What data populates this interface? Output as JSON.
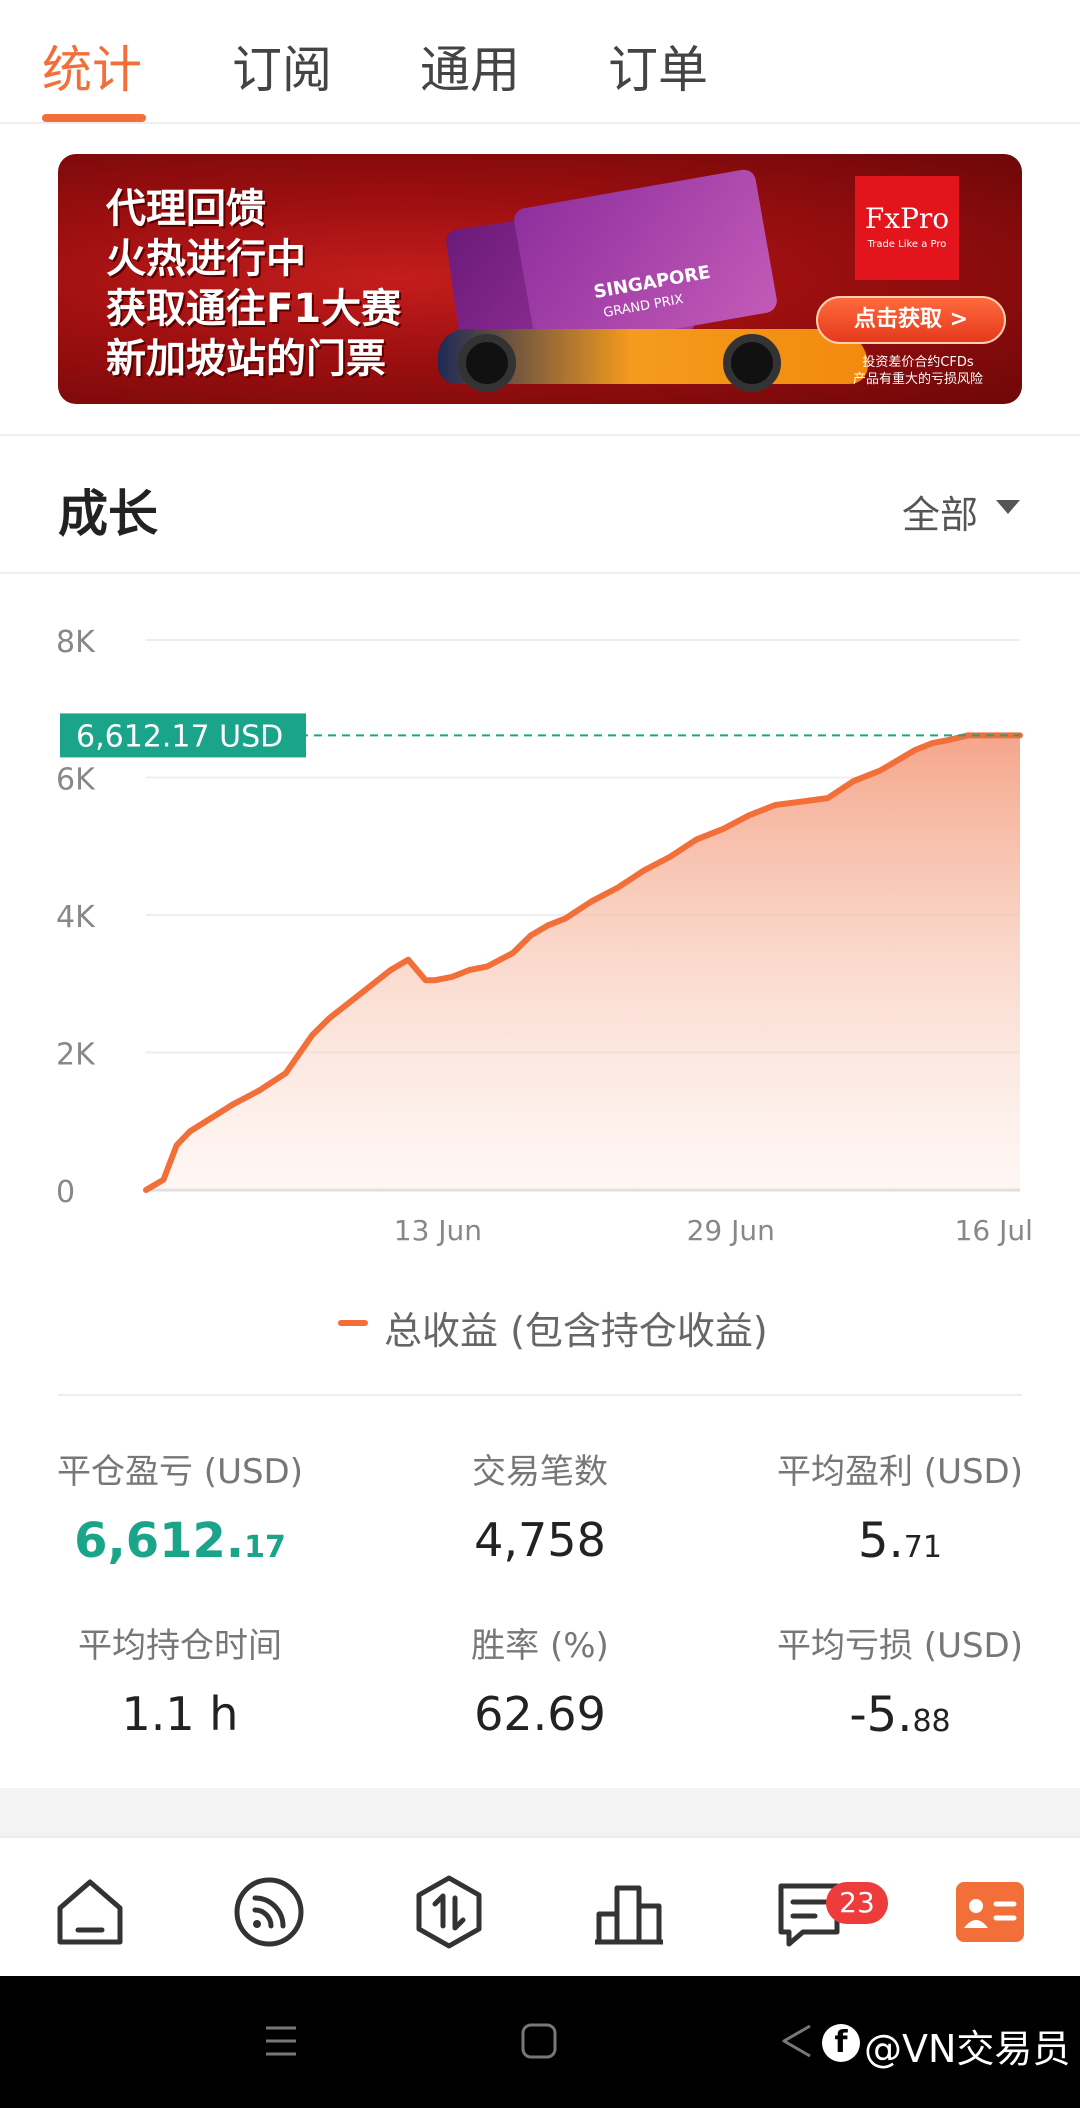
{
  "tabs": [
    {
      "label": "统计",
      "active": true
    },
    {
      "label": "订阅",
      "active": false
    },
    {
      "label": "通用",
      "active": false
    },
    {
      "label": "订单",
      "active": false
    }
  ],
  "banner": {
    "lines": [
      "代理回馈",
      "火热进行中",
      "获取通往F1大赛",
      "新加坡站的门票"
    ],
    "brand": "FxPro",
    "brand_tagline": "Trade Like a Pro",
    "card_title": "SINGAPORE",
    "card_subtitle": "GRAND PRIX",
    "cta": "点击获取 >",
    "risk_line1": "投资差价合约CFDs",
    "risk_line2": "产品有重大的亏损风险"
  },
  "section": {
    "title": "成长",
    "filter": "全部"
  },
  "chart_data": {
    "type": "area",
    "title": "",
    "xlabel": "",
    "ylabel": "",
    "ylim": [
      0,
      8000
    ],
    "y_ticks": [
      "0",
      "2K",
      "4K",
      "6K",
      "8K"
    ],
    "y_tick_values": [
      0,
      2000,
      4000,
      6000,
      8000
    ],
    "x_ticks": [
      "13 Jun",
      "29 Jun",
      "16 Jul"
    ],
    "x_tick_positions": [
      0.334,
      0.669,
      0.97
    ],
    "current_value_label": "6,612.17 USD",
    "current_value": 6612.17,
    "grid": true,
    "series": [
      {
        "name": "总收益 (包含持仓收益)",
        "color": "#f26f3a",
        "x": [
          0.0,
          0.02,
          0.035,
          0.05,
          0.075,
          0.1,
          0.13,
          0.16,
          0.19,
          0.21,
          0.23,
          0.25,
          0.28,
          0.3,
          0.32,
          0.33,
          0.35,
          0.37,
          0.39,
          0.42,
          0.44,
          0.46,
          0.48,
          0.51,
          0.54,
          0.57,
          0.6,
          0.63,
          0.66,
          0.69,
          0.72,
          0.75,
          0.78,
          0.81,
          0.84,
          0.86,
          0.88,
          0.9,
          0.92,
          0.94,
          0.96,
          0.98,
          1.0
        ],
        "values": [
          0,
          150,
          650,
          850,
          1050,
          1250,
          1450,
          1700,
          2250,
          2500,
          2700,
          2900,
          3200,
          3350,
          3050,
          3050,
          3100,
          3200,
          3250,
          3450,
          3700,
          3850,
          3950,
          4200,
          4400,
          4650,
          4850,
          5100,
          5250,
          5450,
          5600,
          5650,
          5700,
          5950,
          6100,
          6250,
          6400,
          6500,
          6550,
          6612.17,
          6612.17,
          6612.17,
          6612.17
        ]
      }
    ]
  },
  "legend": {
    "label": "总收益 (包含持仓收益)"
  },
  "stats": {
    "closed_pnl_label": "平仓盈亏 (USD)",
    "closed_pnl_int": "6,612.",
    "closed_pnl_dec": "17",
    "trades_label": "交易笔数",
    "trades_value": "4,758",
    "avg_profit_label": "平均盈利 (USD)",
    "avg_profit_int": "5.",
    "avg_profit_dec": "71",
    "avg_hold_label": "平均持仓时间",
    "avg_hold_value": "1.1 h",
    "win_rate_label": "胜率 (%)",
    "win_rate_value": "62.69",
    "avg_loss_label": "平均亏损 (USD)",
    "avg_loss_int": "-5.",
    "avg_loss_dec": "88"
  },
  "nav": {
    "items": [
      {
        "icon": "home-icon"
      },
      {
        "icon": "feed-icon"
      },
      {
        "icon": "trade-icon"
      },
      {
        "icon": "ranking-icon"
      },
      {
        "icon": "messages-icon"
      },
      {
        "icon": "profile-card-icon"
      }
    ],
    "badge_count": "23"
  },
  "system": {
    "watermark": "@VN交易员"
  },
  "colors": {
    "accent": "#f26f3a",
    "positive": "#1aa58a",
    "badge": "#ee3b3b"
  }
}
